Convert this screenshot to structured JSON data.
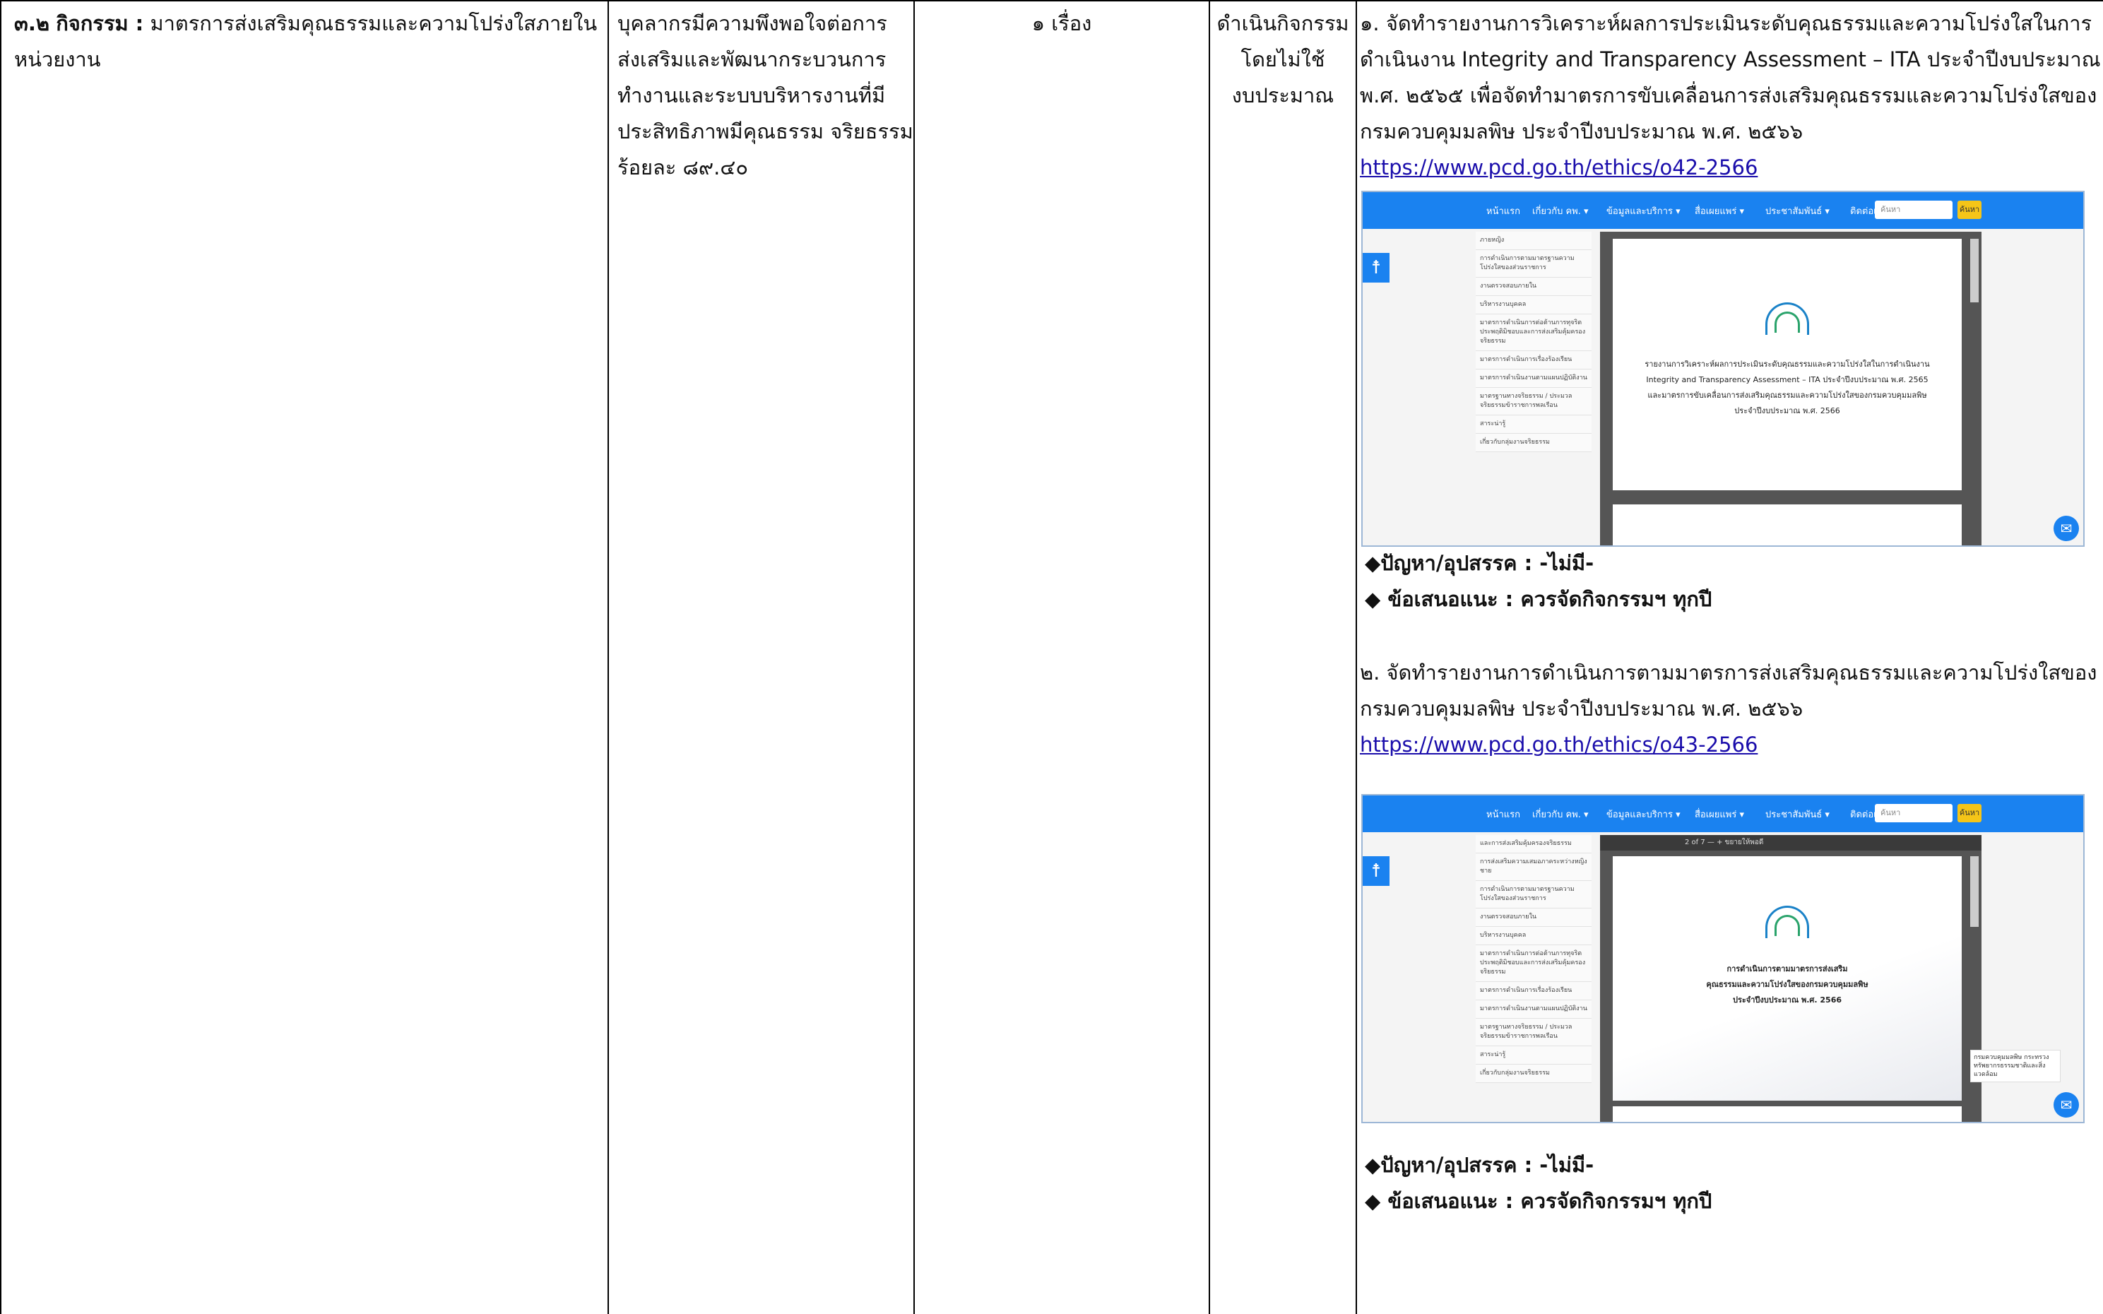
{
  "col1": {
    "code": "๓.๒",
    "label": "กิจกรรม :",
    "text_line1": " มาตรการส่งเสริมคุณธรรมและความโปร่งใสภายใน",
    "text_line2": "หน่วยงาน"
  },
  "col2": {
    "lines": [
      "บุคลากรมีความพึงพอใจต่อการ",
      "ส่งเสริมและพัฒนากระบวนการ",
      "ทำงานและระบบบริหารงานที่มี",
      "ประสิทธิภาพมีคุณธรรม จริยธรรม",
      "ร้อยละ ๘๙.๔๐"
    ]
  },
  "col3": {
    "text": "๑ เรื่อง"
  },
  "col4": {
    "lines": [
      "ดำเนินกิจกรรม",
      "โดยไม่ใช้",
      "งบประมาณ"
    ]
  },
  "col5": {
    "item1": {
      "lines": [
        "๑. จัดทำรายงานการวิเคราะห์ผลการประเมินระดับคุณธรรมและความโปร่งใสในการ",
        "ดำเนินงาน Integrity and Transparency Assessment – ITA ประจำปีงบประมาณ",
        "พ.ศ. ๒๕๖๕ เพื่อจัดทำมาตรการขับเคลื่อนการส่งเสริมคุณธรรมและความโปร่งใสของ",
        "กรมควบคุมมลพิษ ประจำปีงบประมาณ พ.ศ. ๒๕๖๖"
      ],
      "link": "https://www.pcd.go.th/ethics/o42-2566",
      "problem": "◆ปัญหา/อุปสรรค : -ไม่มี-",
      "suggestion": "◆ ข้อเสนอแนะ : ควรจัดกิจกรรมฯ ทุกปี"
    },
    "item2": {
      "lines": [
        " ๒. จัดทำรายงานการดำเนินการตามมาตรการส่งเสริมคุณธรรมและความโปร่งใสของ",
        "กรมควบคุมมลพิษ ประจำปีงบประมาณ พ.ศ. ๒๕๖๖"
      ],
      "link": "https://www.pcd.go.th/ethics/o43-2566",
      "problem": "◆ปัญหา/อุปสรรค : -ไม่มี-",
      "suggestion": "◆ ข้อเสนอแนะ : ควรจัดกิจกรรมฯ ทุกปี"
    }
  },
  "screenshot": {
    "nav_items": [
      "หน้าแรก",
      "เกี่ยวกับ คพ. ▾",
      "ข้อมูลและบริการ ▾",
      "สื่อเผยแพร่ ▾",
      "ประชาสัมพันธ์ ▾",
      "ติดต่อเรา ▾"
    ],
    "search_placeholder": "ค้นหา",
    "search_button": "ค้นหา",
    "accessibility_icon": "accessibility-icon",
    "messenger_icon": "messenger-icon",
    "sidebar1": [
      "ภายหญิง",
      "การดำเนินการตามมาตรฐานความโปร่งใสของส่วนราชการ",
      "งานตรวจสอบภายใน",
      "บริหารงานบุคคล",
      "มาตรการดำเนินการต่อต้านการทุจริต ประพฤติมิชอบและการส่งเสริมคุ้มครองจริยธรรม",
      "มาตรการดำเนินการเรื่องร้องเรียน",
      "มาตรการดำเนินงานตามแผนปฏิบัติงาน",
      "มาตรฐานทางจริยธรรม / ประมวลจริยธรรมข้าราชการพลเรือน",
      "สาระน่ารู้",
      "เกี่ยวกับกลุ่มงานจริยธรรม"
    ],
    "sidebar2": [
      "และการส่งเสริมคุ้มครองจริยธรรม",
      "การส่งเสริมความเสมอภาคระหว่างหญิงชาย",
      "การดำเนินการตามมาตรฐานความโปร่งใสของส่วนราชการ",
      "งานตรวจสอบภายใน",
      "บริหารงานบุคคล",
      "มาตรการดำเนินการต่อต้านการทุจริต ประพฤติมิชอบและการส่งเสริมคุ้มครองจริยธรรม",
      "มาตรการดำเนินการเรื่องร้องเรียน",
      "มาตรการดำเนินงานตามแผนปฏิบัติงาน",
      "มาตรฐานทางจริยธรรม / ประมวลจริยธรรมข้าราชการพลเรือน",
      "สาระน่ารู้",
      "เกี่ยวกับกลุ่มงานจริยธรรม"
    ],
    "doc1_lines": [
      "รายงานการวิเคราะห์ผลการประเมินระดับคุณธรรมและความโปร่งใสในการดำเนินงาน",
      "Integrity and Transparency Assessment – ITA ประจำปีงบประมาณ พ.ศ. 2565",
      "และมาตรการขับเคลื่อนการส่งเสริมคุณธรรมและความโปร่งใสของกรมควบคุมมลพิษ",
      "ประจำปีงบประมาณ พ.ศ. 2566"
    ],
    "doc2_lines": [
      "การดำเนินการตามมาตรการส่งเสริม",
      "คุณธรรมและความโปร่งใสของกรมควบคุมมลพิษ",
      "ประจำปีงบประมาณ พ.ศ. 2566"
    ],
    "viewer_toolbar": "2 of 7   —  +   ขยายให้พอดี",
    "popup_text": "กรมควบคุมมลพิษ กระทรวงทรัพยากรธรรมชาติและสิ่งแวดล้อม"
  }
}
